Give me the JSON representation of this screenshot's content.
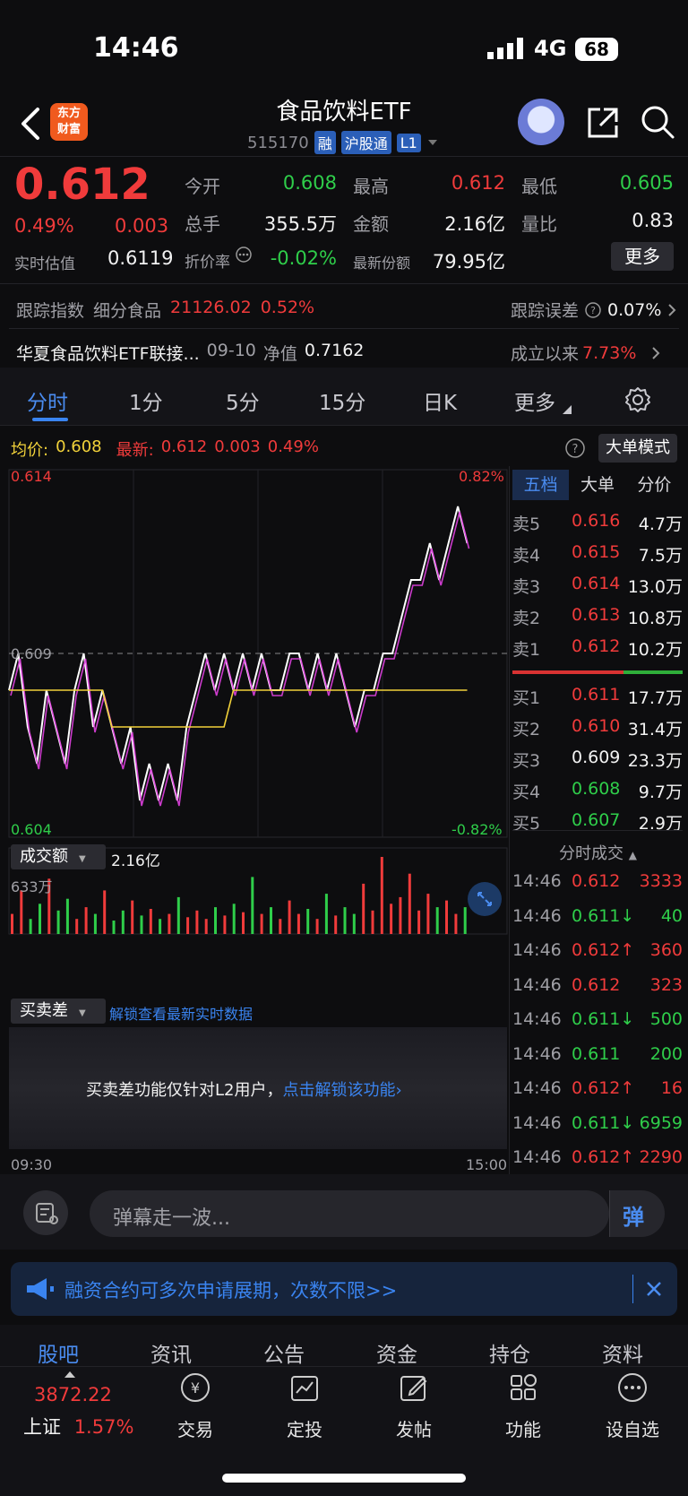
{
  "status": {
    "time": "14:46",
    "network": "4G",
    "battery": "68"
  },
  "header": {
    "logo_line1": "东方",
    "logo_line2": "财富",
    "title": "食品饮料ETF",
    "code": "515170",
    "tags": [
      "融",
      "沪股通",
      "L1"
    ]
  },
  "quote": {
    "price": "0.612",
    "pct": "0.49%",
    "change": "0.003",
    "est_label": "实时估值",
    "est_value": "0.6119",
    "open_label": "今开",
    "open_value": "0.608",
    "high_label": "最高",
    "high_value": "0.612",
    "low_label": "最低",
    "low_value": "0.605",
    "vol_label": "总手",
    "vol_value": "355.5万",
    "amt_label": "金额",
    "amt_value": "2.16亿",
    "ratio_label": "量比",
    "ratio_value": "0.83",
    "discount_label": "折价率",
    "discount_value": "-0.02%",
    "shares_label": "最新份额",
    "shares_value": "79.95亿",
    "more_button": "更多"
  },
  "tracking": {
    "label": "跟踪指数",
    "index_name": "细分食品",
    "index_value": "21126.02",
    "index_pct": "0.52%",
    "error_label": "跟踪误差",
    "error_value": "0.07%"
  },
  "linked": {
    "name": "华夏食品饮料ETF联接...",
    "date": "09-10",
    "nav_label": "净值",
    "nav_value": "0.7162",
    "since_label": "成立以来",
    "since_value": "7.73%"
  },
  "tabs": [
    "分时",
    "1分",
    "5分",
    "15分",
    "日K",
    "更多"
  ],
  "chart_info": {
    "avg_label": "均价:",
    "avg_value": "0.608",
    "latest_label": "最新:",
    "latest_value": "0.612",
    "latest_change": "0.003",
    "latest_pct": "0.49%",
    "mode_button": "大单模式"
  },
  "chart_data": {
    "type": "line",
    "y_left_top": "0.614",
    "y_left_mid": "0.609",
    "y_left_bottom": "0.604",
    "y_right_top": "0.82%",
    "y_right_bottom": "-0.82%",
    "ylim": [
      0.604,
      0.614
    ],
    "x_start": "09:30",
    "x_end": "15:00",
    "series": [
      {
        "values": [
          0.608,
          0.609,
          0.607,
          0.606,
          0.608,
          0.607,
          0.606,
          0.608,
          0.609,
          0.607,
          0.608,
          0.607,
          0.606,
          0.607,
          0.605,
          0.606,
          0.605,
          0.606,
          0.605,
          0.607,
          0.608,
          0.609,
          0.608,
          0.609,
          0.608,
          0.609,
          0.608,
          0.609,
          0.608,
          0.608,
          0.609,
          0.609,
          0.608,
          0.609,
          0.608,
          0.609,
          0.608,
          0.607,
          0.608,
          0.608,
          0.609,
          0.609,
          0.61,
          0.611,
          0.611,
          0.612,
          0.611,
          0.612,
          0.613,
          0.612
        ]
      },
      {
        "values": [
          0.608,
          0.608,
          0.608,
          0.608,
          0.608,
          0.608,
          0.608,
          0.608,
          0.608,
          0.608,
          0.608,
          0.607,
          0.607,
          0.607,
          0.607,
          0.607,
          0.607,
          0.607,
          0.607,
          0.607,
          0.607,
          0.607,
          0.607,
          0.607,
          0.608,
          0.608,
          0.608,
          0.608,
          0.608,
          0.608,
          0.608,
          0.608,
          0.608,
          0.608,
          0.608,
          0.608,
          0.608,
          0.608,
          0.608,
          0.608,
          0.608,
          0.608,
          0.608,
          0.608,
          0.608,
          0.608,
          0.608,
          0.608,
          0.608,
          0.608
        ]
      }
    ],
    "volume_title": "成交额",
    "volume_total": "2.16亿",
    "volume_max": "633万",
    "volume": [
      120,
      260,
      90,
      180,
      330,
      140,
      210,
      90,
      160,
      120,
      260,
      80,
      140,
      200,
      110,
      150,
      90,
      120,
      220,
      100,
      140,
      90,
      160,
      110,
      180,
      130,
      340,
      120,
      160,
      90,
      200,
      120,
      150,
      90,
      240,
      110,
      160,
      120,
      300,
      140,
      460,
      180,
      220,
      360,
      140,
      240,
      160,
      200,
      120,
      160
    ]
  },
  "spread": {
    "title": "买卖差",
    "unlock_text": "解锁查看最新实时数据",
    "notice": "买卖差功能仅针对L2用户，",
    "notice_link": "点击解锁该功能"
  },
  "orderbook": {
    "tabs": [
      "五档",
      "大单",
      "分价"
    ],
    "asks": [
      {
        "label": "卖5",
        "price": "0.616",
        "vol": "4.7万"
      },
      {
        "label": "卖4",
        "price": "0.615",
        "vol": "7.5万"
      },
      {
        "label": "卖3",
        "price": "0.614",
        "vol": "13.0万"
      },
      {
        "label": "卖2",
        "price": "0.613",
        "vol": "10.8万"
      },
      {
        "label": "卖1",
        "price": "0.612",
        "vol": "10.2万"
      }
    ],
    "bids": [
      {
        "label": "买1",
        "price": "0.611",
        "vol": "17.7万"
      },
      {
        "label": "买2",
        "price": "0.610",
        "vol": "31.4万"
      },
      {
        "label": "买3",
        "price": "0.609",
        "vol": "23.3万"
      },
      {
        "label": "买4",
        "price": "0.608",
        "vol": "9.7万"
      },
      {
        "label": "买5",
        "price": "0.607",
        "vol": "2.9万"
      }
    ],
    "ticks_title": "分时成交",
    "ticks": [
      {
        "time": "14:46",
        "price": "0.612",
        "vol": "3333",
        "color": "red"
      },
      {
        "time": "14:46",
        "price": "0.611↓",
        "vol": "40",
        "color": "green"
      },
      {
        "time": "14:46",
        "price": "0.612↑",
        "vol": "360",
        "color": "red"
      },
      {
        "time": "14:46",
        "price": "0.612",
        "vol": "323",
        "color": "red"
      },
      {
        "time": "14:46",
        "price": "0.611↓",
        "vol": "500",
        "color": "green"
      },
      {
        "time": "14:46",
        "price": "0.611",
        "vol": "200",
        "color": "green"
      },
      {
        "time": "14:46",
        "price": "0.612↑",
        "vol": "16",
        "color": "red"
      },
      {
        "time": "14:46",
        "price": "0.611↓",
        "vol": "6959",
        "color": "green"
      },
      {
        "time": "14:46",
        "price": "0.612↑",
        "vol": "2290",
        "color": "red"
      }
    ]
  },
  "comment": {
    "placeholder": "弹幕走一波...",
    "send_icon": "弹"
  },
  "banner": {
    "text": "融资合约可多次申请展期，次数不限>>"
  },
  "bottom_tabs": [
    "股吧",
    "资讯",
    "公告",
    "资金",
    "持仓",
    "资料"
  ],
  "footer": {
    "index_value": "3872.22",
    "index_name": "上证",
    "index_pct": "1.57%",
    "items": [
      "交易",
      "定投",
      "发帖",
      "功能",
      "设自选"
    ]
  },
  "colors": {
    "up": "#f03b3b",
    "down": "#2fce4a",
    "accent": "#3a84f0",
    "avg_line": "#f2d23a",
    "price_line": "#ffffff",
    "price_line2": "#e040e0"
  }
}
